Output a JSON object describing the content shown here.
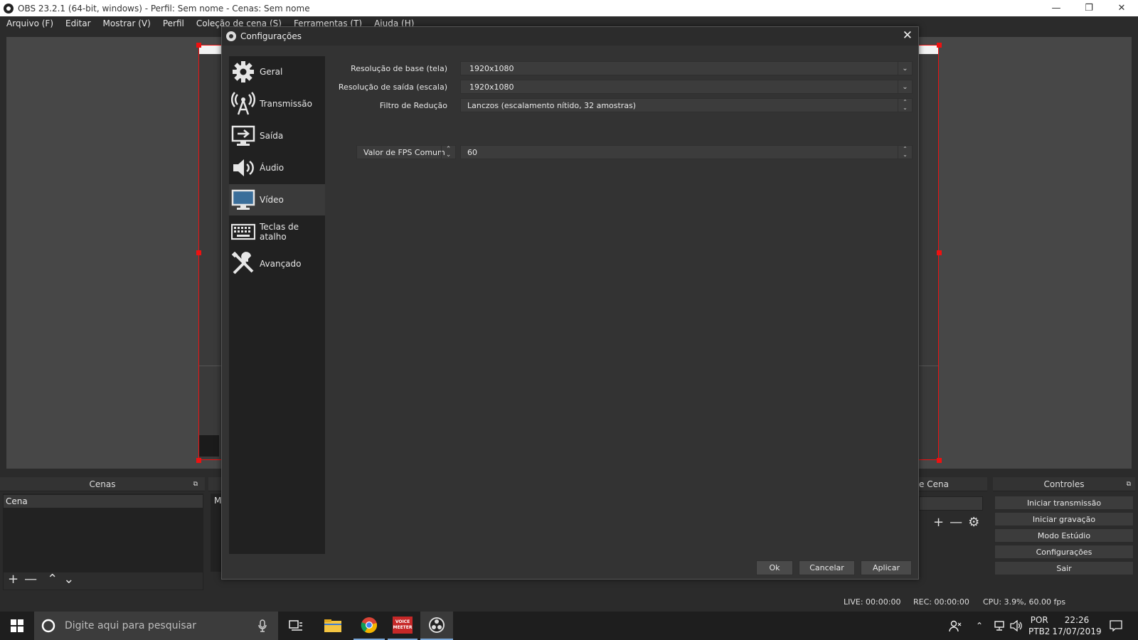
{
  "window": {
    "title": "OBS 23.2.1 (64-bit, windows) - Perfil: Sem nome - Cenas: Sem nome",
    "minimize": "—",
    "maximize": "❐",
    "close": "✕"
  },
  "menu": [
    "Arquivo (F)",
    "Editar",
    "Mostrar (V)",
    "Perfil",
    "Coleção de cena (S)",
    "Ferramentas (T)",
    "Ajuda (H)"
  ],
  "docks": {
    "scenes_title": "Cenas",
    "scenes": [
      "Cena"
    ],
    "sources_partial": "M",
    "transitions_partial": "e Cena",
    "controls_title": "Controles",
    "controls": [
      "Iniciar transmissão",
      "Iniciar gravação",
      "Modo Estúdio",
      "Configurações",
      "Sair"
    ]
  },
  "status": {
    "live": "LIVE: 00:00:00",
    "rec": "REC: 00:00:00",
    "cpu": "CPU: 3.9%, 60.00 fps"
  },
  "dialog": {
    "title": "Configurações",
    "close": "✕",
    "nav": [
      {
        "label": "Geral",
        "icon": "gear-icon"
      },
      {
        "label": "Transmissão",
        "icon": "broadcast-antenna-icon"
      },
      {
        "label": "Saída",
        "icon": "output-monitor-icon"
      },
      {
        "label": "Áudio",
        "icon": "speaker-icon"
      },
      {
        "label": "Vídeo",
        "icon": "monitor-icon"
      },
      {
        "label": "Teclas de atalho",
        "icon": "keyboard-icon"
      },
      {
        "label": "Avançado",
        "icon": "tools-icon"
      }
    ],
    "selected_nav": "Vídeo",
    "fields": {
      "base_res_label": "Resolução de base (tela)",
      "base_res_value": "1920x1080",
      "output_res_label": "Resolução de saída (escala)",
      "output_res_value": "1920x1080",
      "filter_label": "Filtro de Redução",
      "filter_value": "Lanczos (escalamento nítido, 32 amostras)",
      "fps_type": "Valor de FPS Comum",
      "fps_value": "60"
    },
    "buttons": {
      "ok": "Ok",
      "cancel": "Cancelar",
      "apply": "Aplicar"
    }
  },
  "taskbar": {
    "search_placeholder": "Digite aqui para pesquisar",
    "voicemeeter_line1": "VOICE",
    "voicemeeter_line2": "MEETER",
    "lang1": "POR",
    "lang2": "PTB2",
    "time": "22:26",
    "date": "17/07/2019"
  }
}
